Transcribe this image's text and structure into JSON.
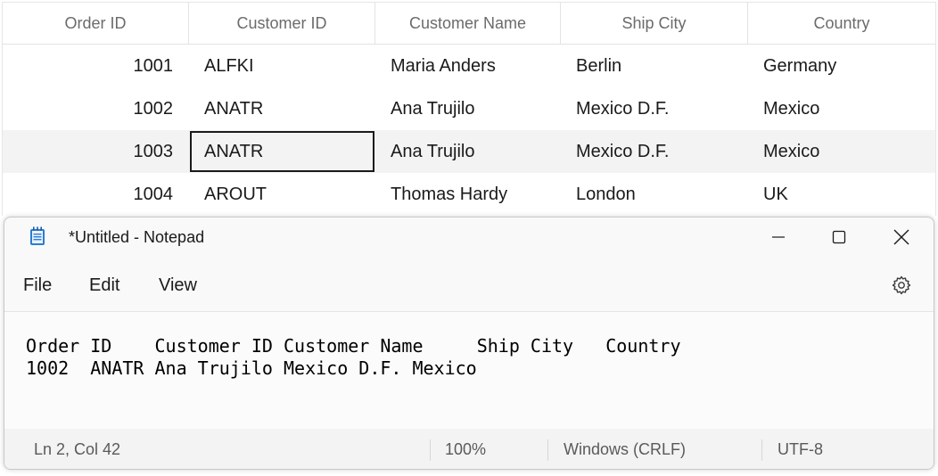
{
  "grid": {
    "columns": [
      "Order ID",
      "Customer ID",
      "Customer Name",
      "Ship City",
      "Country"
    ],
    "rows": [
      {
        "order_id": "1001",
        "customer_id": "ALFKI",
        "customer_name": "Maria Anders",
        "ship_city": "Berlin",
        "country": "Germany"
      },
      {
        "order_id": "1002",
        "customer_id": "ANATR",
        "customer_name": "Ana Trujilo",
        "ship_city": "Mexico D.F.",
        "country": "Mexico"
      },
      {
        "order_id": "1003",
        "customer_id": "ANATR",
        "customer_name": "Ana Trujilo",
        "ship_city": "Mexico D.F.",
        "country": "Mexico"
      },
      {
        "order_id": "1004",
        "customer_id": "AROUT",
        "customer_name": "Thomas Hardy",
        "ship_city": "London",
        "country": "UK"
      }
    ],
    "selected_cell": {
      "row": 3,
      "column": "Customer ID"
    }
  },
  "notepad": {
    "title": "*Untitled - Notepad",
    "icon": "notepad-icon",
    "window_controls": [
      "minimize-icon",
      "maximize-icon",
      "close-icon"
    ],
    "menu": [
      "File",
      "Edit",
      "View"
    ],
    "settings_icon": "gear-icon",
    "content_line1": "Order ID    Customer ID Customer Name     Ship City   Country",
    "content_line2": "1002  ANATR Ana Trujilo Mexico D.F. Mexico",
    "status": {
      "position": "Ln 2, Col 42",
      "zoom": "100%",
      "line_ending": "Windows (CRLF)",
      "encoding": "UTF-8"
    }
  },
  "colors": {
    "grid_alt_row": "#f3f3f3",
    "selection_border": "#1a1a1a",
    "notepad_icon": "#2b7cd3"
  }
}
